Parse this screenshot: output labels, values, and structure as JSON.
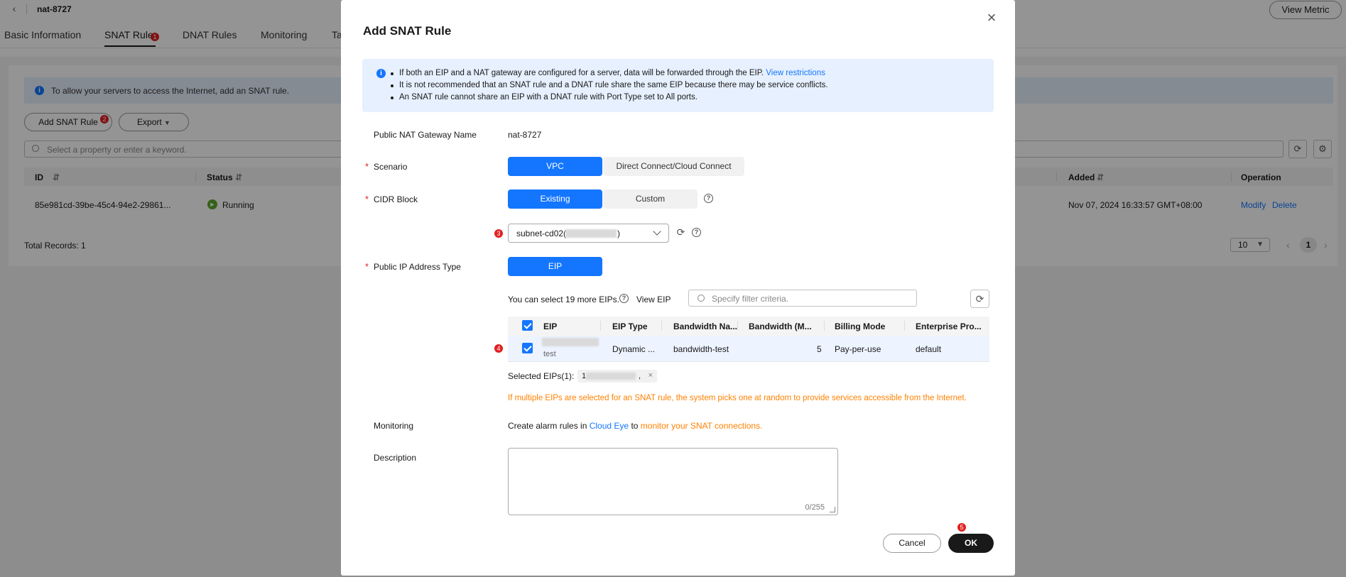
{
  "page": {
    "title": "nat-8727",
    "view_metric_label": "View Metric",
    "tabs": [
      {
        "label": "Basic Information"
      },
      {
        "label": "SNAT Rule"
      },
      {
        "label": "DNAT Rules"
      },
      {
        "label": "Monitoring"
      },
      {
        "label": "Ta"
      }
    ],
    "info_text": "To allow your servers to access the Internet, add an SNAT rule.",
    "add_button_label": "Add SNAT Rule",
    "export_label": "Export",
    "search_placeholder": "Select a property or enter a keyword.",
    "columns": {
      "id": "ID",
      "status": "Status",
      "added": "Added",
      "operation": "Operation"
    },
    "row": {
      "id": "85e981cd-39be-45c4-94e2-29861...",
      "status": "Running",
      "added": "Nov 07, 2024 16:33:57 GMT+08:00",
      "modify": "Modify",
      "delete": "Delete"
    },
    "total_records": "Total Records: 1",
    "page_size": "10",
    "current_page": "1"
  },
  "steps": [
    "1",
    "2",
    "3",
    "4",
    "5"
  ],
  "dialog": {
    "title": "Add SNAT Rule",
    "notices": [
      {
        "text": "If both an EIP and a NAT gateway are configured for a server, data will be forwarded through the EIP.",
        "link": "View restrictions"
      },
      {
        "text": "It is not recommended that an SNAT rule and a DNAT rule share the same EIP because there may be service conflicts."
      },
      {
        "text": "An SNAT rule cannot share an EIP with a DNAT rule with Port Type set to All ports."
      }
    ],
    "gateway_label": "Public NAT Gateway Name",
    "gateway_value": "nat-8727",
    "scenario_label": "Scenario",
    "scenario_options": [
      "VPC",
      "Direct Connect/Cloud Connect"
    ],
    "cidr_label": "CIDR Block",
    "cidr_options": [
      "Existing",
      "Custom"
    ],
    "subnet_prefix": "subnet-cd02(",
    "subnet_suffix": ")",
    "ip_type_label": "Public IP Address Type",
    "ip_type_option": "EIP",
    "eip_quota_text": "You can select 19 more EIPs.",
    "view_eip_label": "View EIP",
    "filter_placeholder": "Specify filter criteria.",
    "eip_columns": [
      "EIP",
      "EIP Type",
      "Bandwidth Na...",
      "Bandwidth (M...",
      "Billing Mode",
      "Enterprise Pro..."
    ],
    "eip_row": {
      "name": "test",
      "type": "Dynamic ...",
      "bandwidth_name": "bandwidth-test",
      "bandwidth": "5",
      "billing": "Pay-per-use",
      "project": "default"
    },
    "selected_label": "Selected EIPs(1):",
    "selected_tag_prefix": "1",
    "selected_tag_suffix": ",",
    "warning": "If multiple EIPs are selected for an SNAT rule, the system picks one at random to provide services accessible from the Internet.",
    "monitoring_label": "Monitoring",
    "monitoring_text": "Create alarm rules in",
    "cloud_eye": "Cloud Eye",
    "monitoring_to": "to",
    "monitoring_link": "monitor your SNAT connections.",
    "description_label": "Description",
    "char_count": "0/255",
    "cancel_label": "Cancel",
    "ok_label": "OK"
  },
  "colors": {
    "primary": "#1476ff",
    "badge": "#e02020",
    "warning": "#ff8000",
    "running": "#5aa928",
    "ok_button": "#191919"
  }
}
